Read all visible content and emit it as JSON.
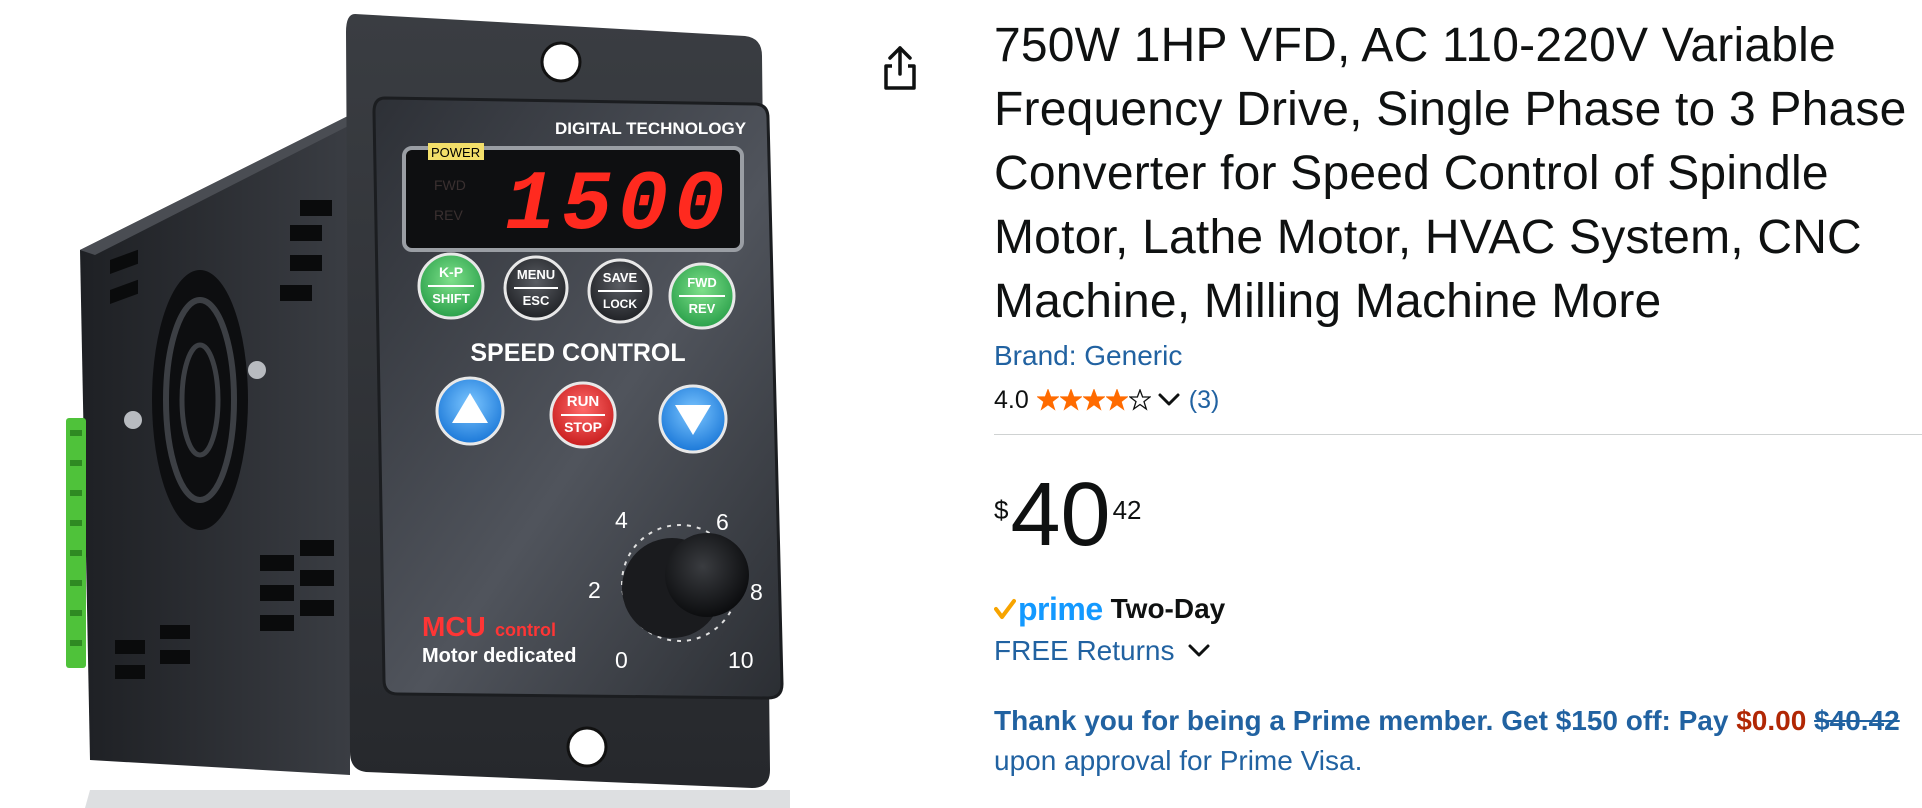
{
  "product": {
    "title": "750W 1HP VFD, AC 110-220V Variable Frequency Drive, Single Phase to 3 Phase Converter for Speed Control of Spindle Motor, Lathe Motor, HVAC System, CNC Machine, Milling Machine More",
    "brand_label": "Brand: Generic",
    "rating": "4.0",
    "rating_value": 4.0,
    "rating_max": 5,
    "review_count": "(3)",
    "price": {
      "symbol": "$",
      "whole": "40",
      "fraction": "42"
    },
    "shipping": {
      "prime_word": "prime",
      "speed": "Two-Day"
    },
    "returns_label": "FREE Returns",
    "promo": {
      "text_before": "Thank you for being a Prime member. Get $150 off: Pay",
      "pay_amount": "$0.00",
      "struck_price": "$40.42",
      "text_after": "upon approval for Prime Visa."
    }
  },
  "image": {
    "display_text": "1500",
    "header_text": "DIGITAL TECHNOLOGY",
    "power_label": "POWER",
    "fwd_indicator": "FWD",
    "rev_indicator": "REV",
    "buttons": {
      "kp_top": "K-P",
      "kp_bottom": "SHIFT",
      "menu_top": "MENU",
      "menu_bottom": "ESC",
      "save_top": "SAVE",
      "save_bottom": "LOCK",
      "fwd_top": "FWD",
      "fwd_bottom": "REV",
      "run_top": "RUN",
      "run_bottom": "STOP"
    },
    "speed_control_label": "SPEED CONTROL",
    "dial_labels": [
      "0",
      "2",
      "4",
      "6",
      "8",
      "10"
    ],
    "mcu_label": "MCU",
    "control_label": "control",
    "motor_label": "Motor dedicated"
  },
  "colors": {
    "link": "#2162a1",
    "price_red": "#b12704",
    "star": "#ff6b00",
    "prime_blue": "#1399ff",
    "prime_check": "#f7a400"
  },
  "icons": {
    "share": "share-icon",
    "star": "star-icon",
    "chevron": "chevron-down-icon",
    "prime_check": "prime-check-icon"
  }
}
